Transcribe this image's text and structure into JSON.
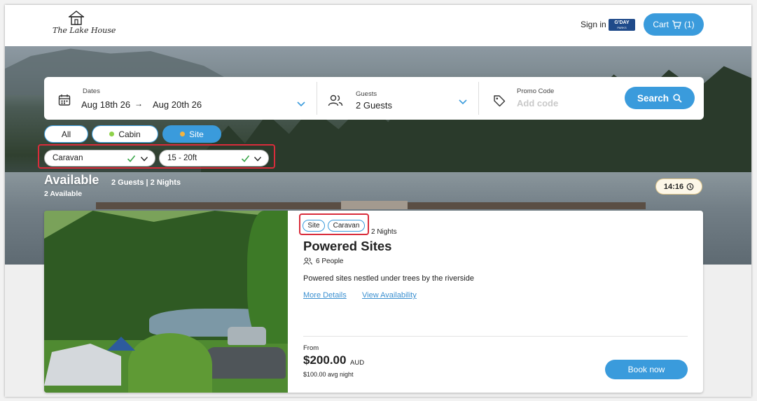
{
  "header": {
    "logo_text": "The Lake House",
    "sign_in": "Sign in",
    "gday_badge": "G'DAY",
    "gday_sub": "PARKS",
    "cart_label": "Cart",
    "cart_count": "(1)"
  },
  "search": {
    "dates_label": "Dates",
    "date_from": "Aug 18th 26",
    "date_arrow": "→",
    "date_to": "Aug 20th 26",
    "guests_label": "Guests",
    "guests_value": "2 Guests",
    "promo_label": "Promo Code",
    "promo_placeholder": "Add code",
    "search_button": "Search"
  },
  "filters": {
    "types": [
      {
        "label": "All",
        "selected": false
      },
      {
        "label": "Cabin",
        "selected": false,
        "dot_color": "#8ed14a"
      },
      {
        "label": "Site",
        "selected": true,
        "dot_color": "#f2b441"
      }
    ],
    "selects": [
      {
        "value": "Caravan"
      },
      {
        "value": "15 - 20ft"
      }
    ]
  },
  "availability": {
    "title": "Available",
    "summary": "2 Guests | 2 Nights",
    "count": "2 Available",
    "timer": "14:16"
  },
  "listing": {
    "tags": [
      "Site",
      "Caravan"
    ],
    "nights": "2 Nights",
    "title": "Powered Sites",
    "people": "6 People",
    "description": "Powered sites nestled under trees by the riverside",
    "more_details": "More Details",
    "view_availability": "View Availability",
    "from_label": "From",
    "price": "$200.00",
    "currency": "AUD",
    "avg_night": "$100.00 avg night",
    "book_button": "Book now"
  },
  "colors": {
    "accent": "#3a9bdc",
    "highlight": "#d92c3b"
  }
}
